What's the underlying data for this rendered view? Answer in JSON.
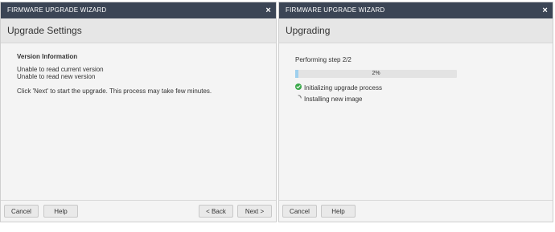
{
  "left_dialog": {
    "title": "FIRMWARE UPGRADE WIZARD",
    "close_glyph": "×",
    "header": "Upgrade Settings",
    "section_title": "Version Information",
    "line1": "Unable to read current version",
    "line2": "Unable to read new version",
    "instruction": "Click 'Next' to start the upgrade. This process may take few minutes.",
    "buttons": {
      "cancel": "Cancel",
      "help": "Help",
      "back": "< Back",
      "next": "Next >"
    }
  },
  "right_dialog": {
    "title": "FIRMWARE UPGRADE WIZARD",
    "close_glyph": "×",
    "header": "Upgrading",
    "step_text": "Performing step 2/2",
    "progress": {
      "percent": 2,
      "label": "2%"
    },
    "steps": [
      {
        "label": "Initializing upgrade process",
        "status": "done",
        "icon": "check-circle-icon"
      },
      {
        "label": "Installing new image",
        "status": "in-progress",
        "icon": "spinner-icon"
      }
    ],
    "buttons": {
      "cancel": "Cancel",
      "help": "Help"
    }
  },
  "colors": {
    "titlebar": "#3b4555",
    "header_bg": "#e6e6e6",
    "progress_fill": "#9fd0ee",
    "success": "#3aa84a"
  }
}
